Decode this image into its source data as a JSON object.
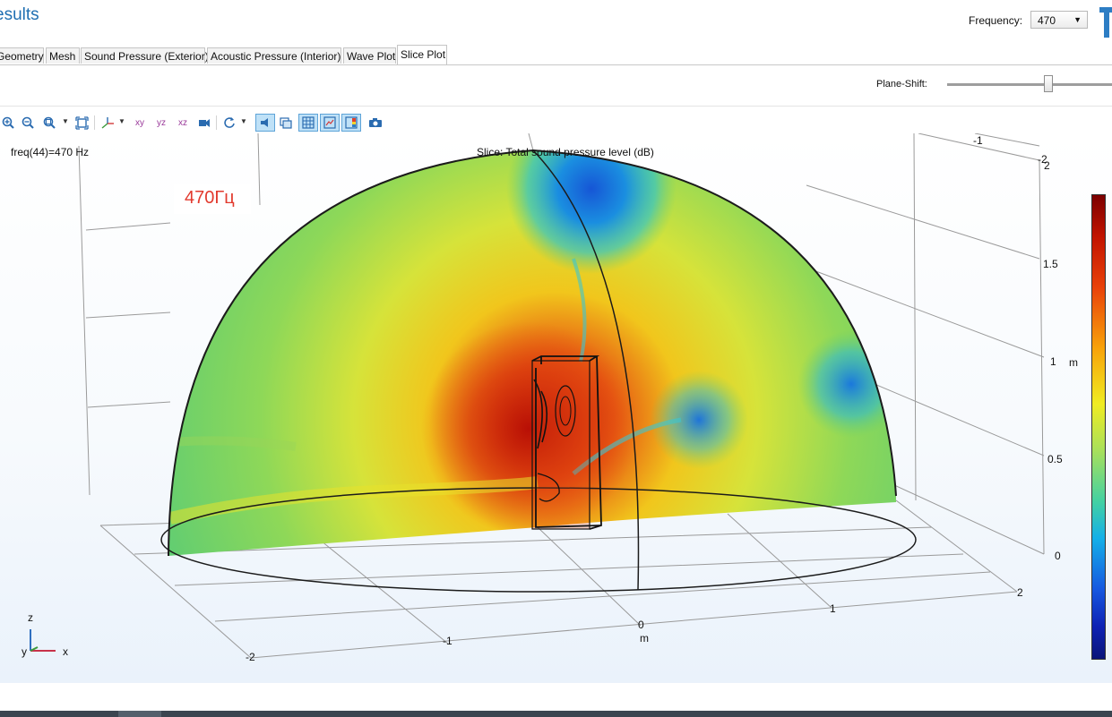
{
  "window": {
    "title": "esults"
  },
  "frequency": {
    "label": "Frequency:",
    "value": "470"
  },
  "tabs": [
    {
      "label": "Geometry",
      "active": false
    },
    {
      "label": "Mesh",
      "active": false
    },
    {
      "label": "Sound Pressure (Exterior)",
      "active": false
    },
    {
      "label": "Acoustic Pressure (Interior)",
      "active": false
    },
    {
      "label": "Wave Plot",
      "active": false
    },
    {
      "label": "Slice Plot",
      "active": true
    }
  ],
  "plane_shift": {
    "label": "Plane-Shift:",
    "value_fraction": 0.61
  },
  "toolbar": {
    "buttons": [
      "zoom-in-icon",
      "zoom-out-icon",
      "zoom-box-icon",
      "zoom-extents-icon",
      "axis-orientation-icon",
      "view-xy-icon",
      "view-yz-icon",
      "view-xz-icon",
      "camera-view-icon",
      "rotate-icon",
      "lighting-icon",
      "transparency-icon",
      "grid-icon",
      "axes-icon",
      "colorbar-icon",
      "screenshot-icon"
    ],
    "view_labels": {
      "xy": "xy",
      "yz": "yz",
      "xz": "xz"
    }
  },
  "plot": {
    "freq_text": "freq(44)=470 Hz",
    "title": "Slice: Total sound pressure level (dB)",
    "annotation": "470Гц",
    "z_ticks": [
      "2",
      "1.5",
      "1",
      "0.5",
      "0"
    ],
    "z_unit": "m",
    "z_top_extra": "-2",
    "y_back_tick": "-1",
    "x_ticks": [
      "-2",
      "-1",
      "0",
      "1",
      "2"
    ],
    "x_unit": "m",
    "triad": {
      "z": "z",
      "y": "y",
      "x": "x"
    }
  },
  "colors": {
    "title_blue": "#1f6fb2",
    "annotation_red": "#e23a2e",
    "colormap": [
      "#7c0000",
      "#e9420a",
      "#f8a20a",
      "#f0ec22",
      "#44d1a2",
      "#14b0e8",
      "#1658e0",
      "#0a1479"
    ]
  }
}
